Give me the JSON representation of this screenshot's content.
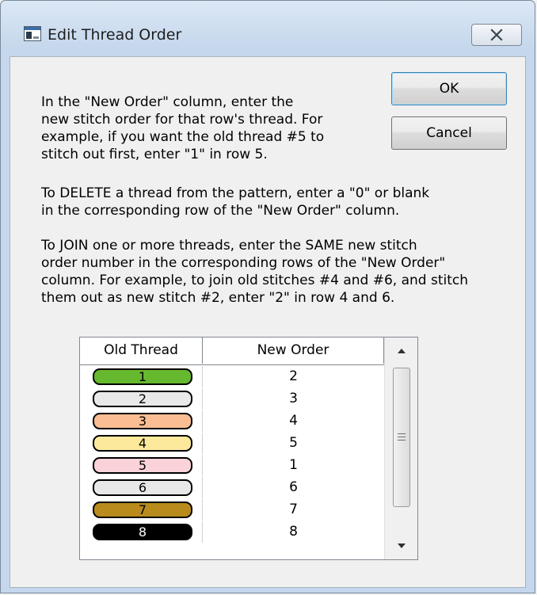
{
  "window": {
    "title": "Edit Thread Order"
  },
  "buttons": {
    "ok": "OK",
    "cancel": "Cancel"
  },
  "instructions": {
    "p1": [
      "In the \"New Order\" column, enter the",
      "new stitch order for that row's thread. For",
      "example, if you want the old thread #5 to",
      "stitch out first, enter \"1\" in row 5."
    ],
    "p2": [
      "To DELETE a thread from the pattern, enter a \"0\" or blank",
      "in the corresponding row of the \"New Order\" column."
    ],
    "p3": [
      "To JOIN one or more threads, enter the SAME new stitch",
      "order number in the corresponding rows of the \"New Order\"",
      "column. For example, to join old stitches #4 and #6, and stitch",
      "them out as new stitch #2, enter \"2\" in row 4 and 6."
    ]
  },
  "table": {
    "columns": [
      "Old Thread",
      "New Order"
    ],
    "rows": [
      {
        "old": "1",
        "new": "2",
        "color": "#66b82e"
      },
      {
        "old": "2",
        "new": "3",
        "color": "#e8e8e8"
      },
      {
        "old": "3",
        "new": "4",
        "color": "#fbbd92"
      },
      {
        "old": "4",
        "new": "5",
        "color": "#fde99c"
      },
      {
        "old": "5",
        "new": "1",
        "color": "#f9d3d9"
      },
      {
        "old": "6",
        "new": "6",
        "color": "#e8e8e8"
      },
      {
        "old": "7",
        "new": "7",
        "color": "#b98b1c"
      },
      {
        "old": "8",
        "new": "8",
        "color": "#000000"
      }
    ]
  }
}
